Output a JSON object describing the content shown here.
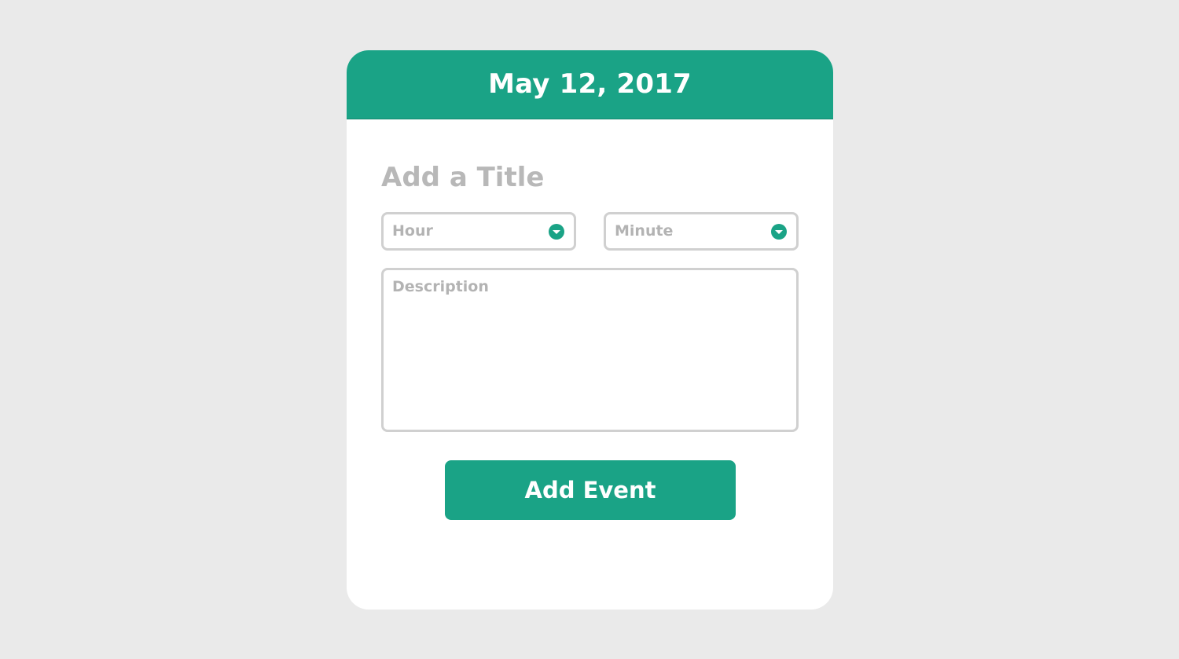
{
  "header": {
    "date": "May 12, 2017"
  },
  "form": {
    "title_placeholder": "Add a Title",
    "title_value": "",
    "hour": {
      "placeholder": "Hour",
      "icon": "chevron-down-icon"
    },
    "minute": {
      "placeholder": "Minute",
      "icon": "chevron-down-icon"
    },
    "description_placeholder": "Description",
    "description_value": "",
    "submit_label": "Add Event"
  },
  "colors": {
    "accent": "#1aa386",
    "background": "#eaeaea",
    "card": "#ffffff",
    "placeholder_text": "#b3b3b3",
    "field_border": "#d0d0d0"
  }
}
